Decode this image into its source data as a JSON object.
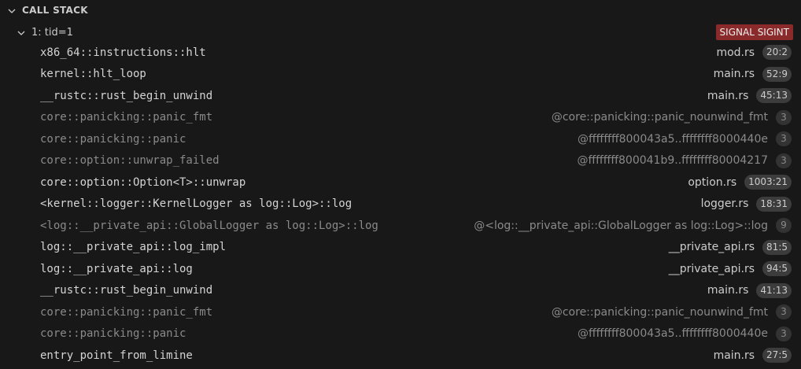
{
  "panel": {
    "title": "CALL STACK"
  },
  "thread": {
    "label": "1: tid=1",
    "status": "SIGNAL SIGINT"
  },
  "frames": [
    {
      "name": "x86_64::instructions::hlt",
      "location": "mod.rs",
      "badge": "20:2",
      "dim": false
    },
    {
      "name": "kernel::hlt_loop",
      "location": "main.rs",
      "badge": "52:9",
      "dim": false
    },
    {
      "name": "__rustc::rust_begin_unwind",
      "location": "main.rs",
      "badge": "45:13",
      "dim": false
    },
    {
      "name": "core::panicking::panic_fmt",
      "location": "@core::panicking::panic_nounwind_fmt",
      "badge": "3",
      "dim": true
    },
    {
      "name": "core::panicking::panic",
      "location": "@ffffffff800043a5..ffffffff8000440e",
      "badge": "3",
      "dim": true
    },
    {
      "name": "core::option::unwrap_failed",
      "location": "@ffffffff800041b9..ffffffff80004217",
      "badge": "3",
      "dim": true
    },
    {
      "name": "core::option::Option<T>::unwrap",
      "location": "option.rs",
      "badge": "1003:21",
      "dim": false
    },
    {
      "name": "<kernel::logger::KernelLogger as log::Log>::log",
      "location": "logger.rs",
      "badge": "18:31",
      "dim": false
    },
    {
      "name": "<log::__private_api::GlobalLogger as log::Log>::log",
      "location": "@<log::__private_api::GlobalLogger as log::Log>::log",
      "badge": "9",
      "dim": true
    },
    {
      "name": "log::__private_api::log_impl",
      "location": "__private_api.rs",
      "badge": "81:5",
      "dim": false
    },
    {
      "name": "log::__private_api::log",
      "location": "__private_api.rs",
      "badge": "94:5",
      "dim": false
    },
    {
      "name": "__rustc::rust_begin_unwind",
      "location": "main.rs",
      "badge": "41:13",
      "dim": false
    },
    {
      "name": "core::panicking::panic_fmt",
      "location": "@core::panicking::panic_nounwind_fmt",
      "badge": "3",
      "dim": true
    },
    {
      "name": "core::panicking::panic",
      "location": "@ffffffff800043a5..ffffffff8000440e",
      "badge": "3",
      "dim": true
    },
    {
      "name": "entry_point_from_limine",
      "location": "main.rs",
      "badge": "27:5",
      "dim": false
    }
  ],
  "icons": {
    "section_chevron": "chevron-down-icon",
    "thread_chevron": "chevron-down-icon"
  },
  "colors": {
    "background": "#181818",
    "signal_badge": "#8a2a2a"
  }
}
